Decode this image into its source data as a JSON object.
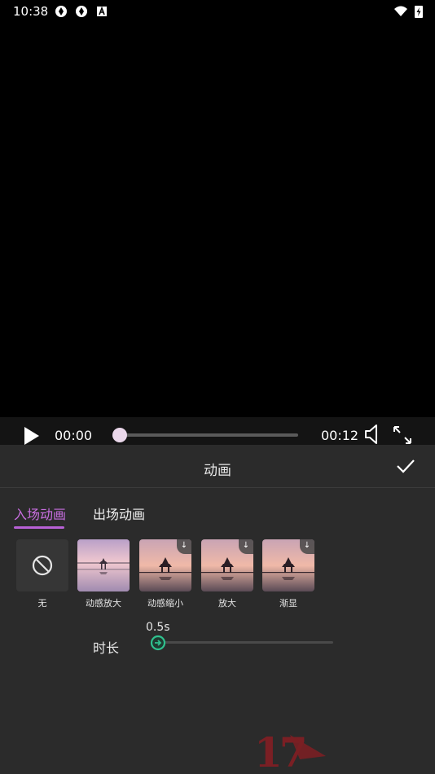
{
  "status_bar": {
    "time": "10:38"
  },
  "player": {
    "current_time": "00:00",
    "total_time": "00:12",
    "progress": 0.0
  },
  "panel": {
    "title": "动画",
    "tabs": [
      {
        "label": "入场动画",
        "selected": true
      },
      {
        "label": "出场动画",
        "selected": false
      }
    ],
    "animations": [
      {
        "label": "无",
        "icon": "ban-icon",
        "selected": false,
        "download": false
      },
      {
        "label": "动感放大",
        "icon": "pagoda-thumbnail",
        "selected": true,
        "download": false
      },
      {
        "label": "动感缩小",
        "icon": "pagoda-thumbnail",
        "selected": false,
        "download": true
      },
      {
        "label": "放大",
        "icon": "pagoda-thumbnail",
        "selected": false,
        "download": true
      },
      {
        "label": "渐显",
        "icon": "pagoda-thumbnail",
        "selected": false,
        "download": true
      }
    ],
    "duration": {
      "label": "时长",
      "value": "0.5s"
    }
  },
  "watermark": {
    "text": "17"
  },
  "colors": {
    "accent": "#b861d6",
    "slider": "#2fc18e",
    "panel_bg": "#2b2b2b"
  }
}
